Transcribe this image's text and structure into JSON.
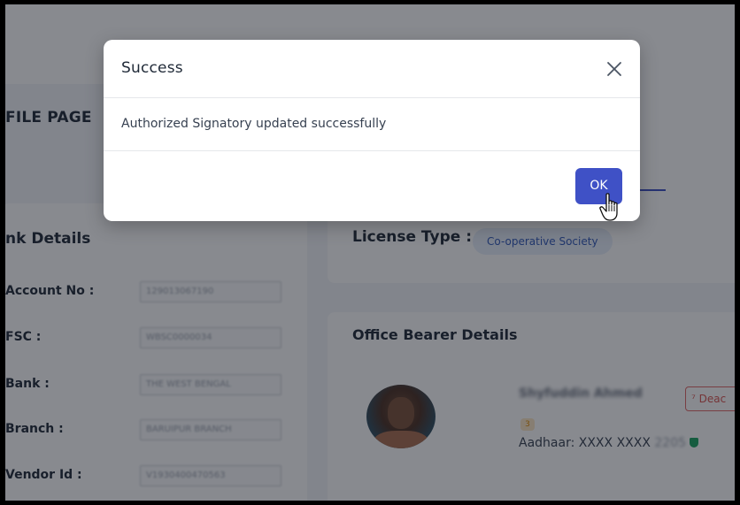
{
  "background_page": {
    "profile_title": "FILE PAGE",
    "bank_details": {
      "title": "nk Details",
      "rows": [
        {
          "label": "Account No :",
          "value": "129013067190"
        },
        {
          "label": "FSC :",
          "value": "WBSC0000034"
        },
        {
          "label": "Bank :",
          "value": "THE WEST BENGAL"
        },
        {
          "label": "Branch :",
          "value": "BARUIPUR BRANCH"
        },
        {
          "label": "Vendor Id :",
          "value": "V1930400470563"
        }
      ]
    },
    "license": {
      "label": "License Type :",
      "chip": "Co-operative Society"
    },
    "office_bearer": {
      "title": "Office Bearer Details",
      "name": "Shyfuddin Ahmed",
      "deactivate_label": "⁷ Deac",
      "badge": "3",
      "aadhaar_prefix": "Aadhaar: XXXX XXXX ",
      "aadhaar_suffix": "2205"
    }
  },
  "modal": {
    "title": "Success",
    "message": "Authorized Signatory updated successfully",
    "ok_label": "OK",
    "close_icon": "close-icon"
  },
  "colors": {
    "primary": "#3f51c6",
    "overlay": "rgba(18,22,32,0.5)",
    "danger": "#d9534f",
    "chip_text": "#3159b8",
    "verified": "#1aa260"
  }
}
